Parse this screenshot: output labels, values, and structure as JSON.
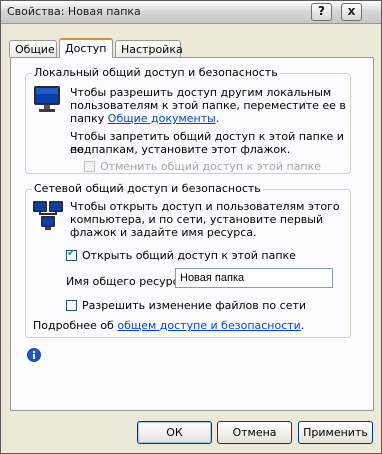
{
  "window": {
    "title": "Свойства: Новая папка"
  },
  "titlebar": {
    "help_label": "?",
    "close_label": "x"
  },
  "tabs": [
    {
      "label": "Общие"
    },
    {
      "label": "Доступ"
    },
    {
      "label": "Настройка"
    }
  ],
  "local_group": {
    "legend": "Локальный общий доступ и безопасность",
    "text1_line1": "Чтобы разрешить доступ другим локальным",
    "text1_line2": "пользователям к этой папке, переместите ее в",
    "text1_line3_prefix": "папку ",
    "text1_link": "Общие документы",
    "text1_line3_suffix": ".",
    "text2_line1": "Чтобы запретить общий доступ к этой папке и ее",
    "text2_line2": "подпапкам, установите этот флажок.",
    "checkbox_label": "Отменить общий доступ к этой папке",
    "checkbox_checked": false,
    "checkbox_disabled": true
  },
  "network_group": {
    "legend": "Сетевой общий доступ и безопасность",
    "text_line1": "Чтобы открыть доступ и пользователям этого",
    "text_line2": "компьютера, и по сети, установите первый",
    "text_line3": "флажок и задайте имя ресурса.",
    "share_checkbox_label": "Открыть общий доступ к этой папке",
    "share_checkbox_checked": true,
    "share_name_label": "Имя общего ресурса:",
    "share_name_value": "Новая папка",
    "allow_change_label": "Разрешить изменение файлов по сети",
    "allow_change_checked": false,
    "more_prefix": "Подробнее об ",
    "more_link": "общем доступе и безопасности",
    "more_suffix": "."
  },
  "buttons": {
    "ok": "ОК",
    "cancel": "Отмена",
    "apply": "Применить"
  },
  "icons": {
    "local_group_icon": "monitor-icon",
    "network_group_icon": "network-computers-icon",
    "info_icon": "info-icon"
  },
  "colors": {
    "accent_tab": "#e68b2c",
    "link": "#0046d5",
    "dialog_bg": "#ece9d8",
    "panel_bg": "#fcfcfe"
  }
}
